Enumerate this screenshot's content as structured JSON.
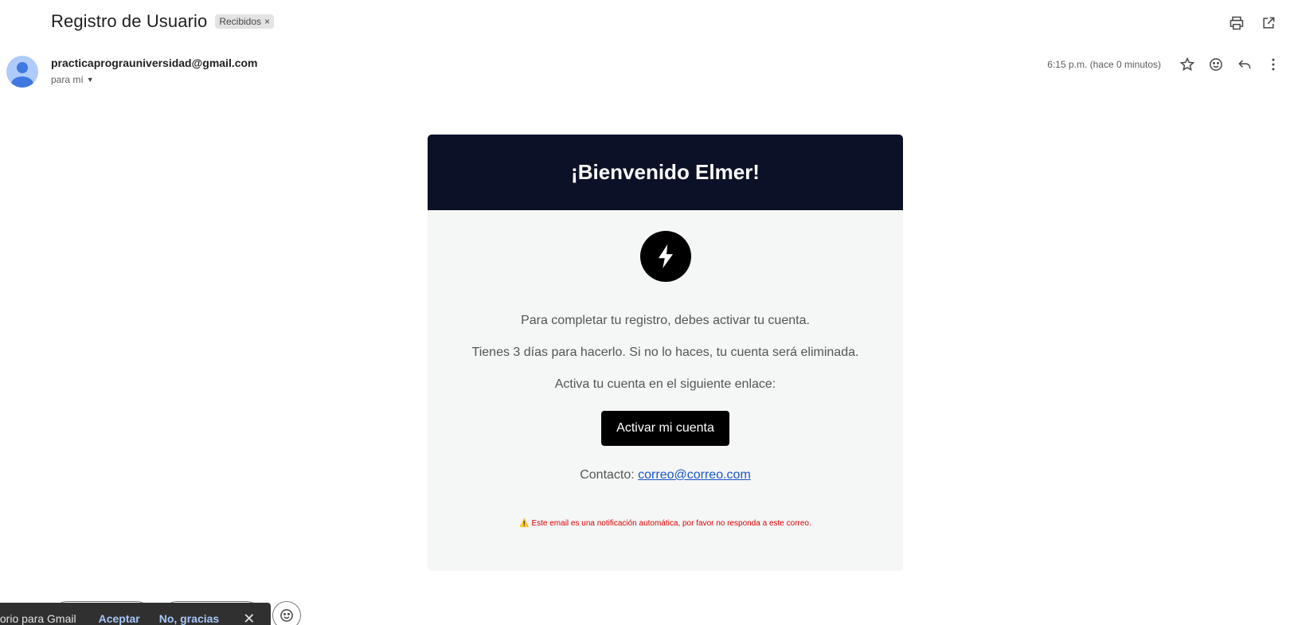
{
  "email": {
    "subject": "Registro de Usuario",
    "label": "Recibidos",
    "label_remove": "×",
    "sender_email": "practicaprograuniversidad@gmail.com",
    "to_text": "para mí",
    "timestamp": "6:15 p.m. (hace 0 minutos)"
  },
  "icons": [
    "print-icon",
    "open-in-new-window-icon",
    "star-icon",
    "emoji-icon",
    "reply-icon",
    "more-vert-icon",
    "bolt-icon",
    "warning-icon",
    "close-icon"
  ],
  "message": {
    "header_title": "¡Bienvenido Elmer!",
    "line1": "Para completar tu registro, debes activar tu cuenta.",
    "line2": "Tienes 3 días para hacerlo. Si no lo haces, tu cuenta será eliminada.",
    "line3": "Activa tu cuenta en el siguiente enlace:",
    "button_label": "Activar mi cuenta",
    "contact_label": "Contacto:",
    "contact_email": "correo@correo.com",
    "warning_emoji": "⚠️",
    "warning_text": "Este email es una notificación automática, por favor no responda a este correo.",
    "header_bg": "#0b1227",
    "button_bg": "#000000",
    "warning_color": "#e00000"
  },
  "snackbar": {
    "text": "torio para Gmail",
    "accept_label": "Aceptar",
    "decline_label": "No, gracias",
    "close_label": "✕"
  }
}
